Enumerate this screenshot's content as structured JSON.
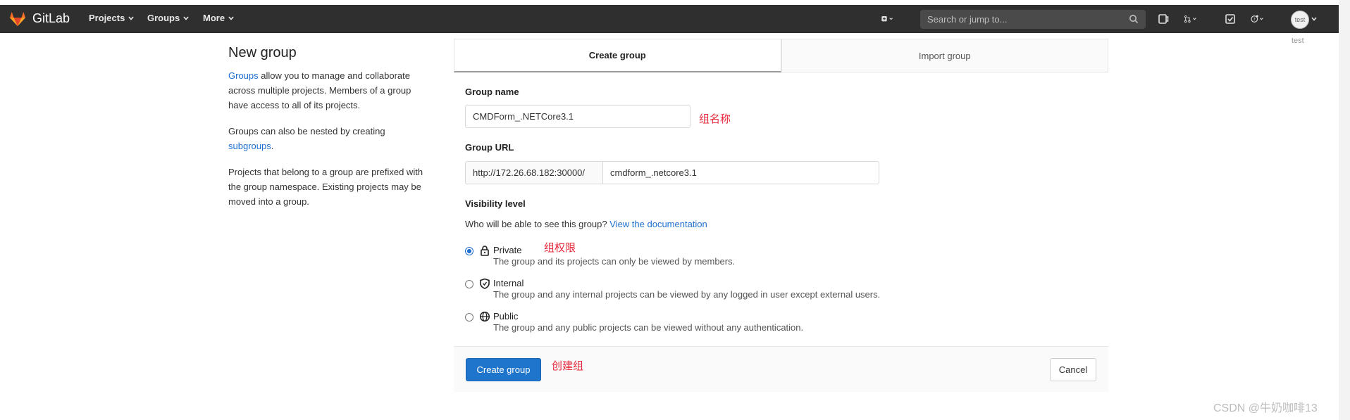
{
  "navbar": {
    "brand": "GitLab",
    "menus": [
      {
        "label": "Projects"
      },
      {
        "label": "Groups"
      },
      {
        "label": "More"
      }
    ],
    "search_placeholder": "Search or jump to...",
    "user_alt": "test"
  },
  "sidebar": {
    "title": "New group",
    "p1_link": "Groups",
    "p1_text": " allow you to manage and collaborate across multiple projects. Members of a group have access to all of its projects.",
    "p2_text": "Groups can also be nested by creating ",
    "p2_link": "subgroups",
    "p2_end": ".",
    "p3_text": "Projects that belong to a group are prefixed with the group namespace. Existing projects may be moved into a group."
  },
  "tabs": [
    {
      "label": "Create group",
      "active": true
    },
    {
      "label": "Import group",
      "active": false
    }
  ],
  "form": {
    "group_name_label": "Group name",
    "group_name_value": "CMDForm_.NETCore3.1",
    "group_name_annot": "组名称",
    "group_url_label": "Group URL",
    "group_url_prefix": "http://172.26.68.182:30000/",
    "group_url_value": "cmdform_.netcore3.1",
    "visibility_label": "Visibility level",
    "visibility_question": "Who will be able to see this group?",
    "visibility_doc_link": "View the documentation",
    "visibility_annot": "组权限",
    "options": [
      {
        "title": "Private",
        "desc": "The group and its projects can only be viewed by members.",
        "checked": true,
        "icon": "lock-icon"
      },
      {
        "title": "Internal",
        "desc": "The group and any internal projects can be viewed by any logged in user except external users.",
        "checked": false,
        "icon": "shield-icon"
      },
      {
        "title": "Public",
        "desc": "The group and any public projects can be viewed without any authentication.",
        "checked": false,
        "icon": "globe-icon"
      }
    ],
    "submit_label": "Create group",
    "submit_annot": "创建组",
    "cancel_label": "Cancel"
  },
  "watermark": "CSDN @牛奶咖啡13",
  "colors": {
    "navbar": "#2f2f2f",
    "primary": "#1f75cb",
    "link": "#1f6fd0",
    "annotation": "#e5283a"
  }
}
